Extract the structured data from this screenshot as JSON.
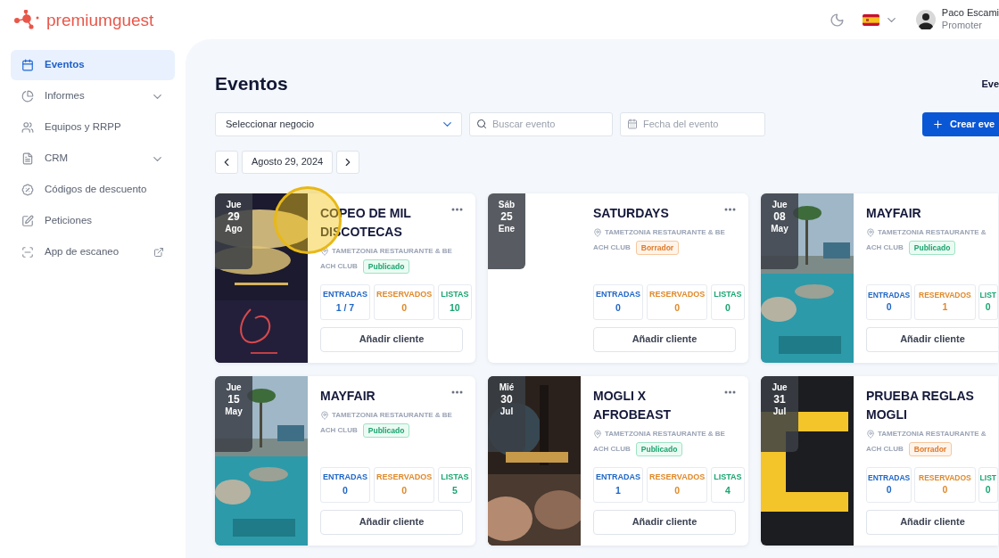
{
  "brand": {
    "name_light": "premium",
    "name_regular": "guest"
  },
  "topbar": {
    "user": {
      "name": "Paco Escami",
      "role": "Promoter"
    }
  },
  "sidebar": {
    "items": [
      {
        "label": "Eventos",
        "selected": true
      },
      {
        "label": "Informes",
        "selected": false,
        "has_submenu": true
      },
      {
        "label": "Equipos y RRPP",
        "selected": false
      },
      {
        "label": "CRM",
        "selected": false,
        "has_submenu": true
      },
      {
        "label": "Códigos de descuento",
        "selected": false
      },
      {
        "label": "Peticiones",
        "selected": false
      },
      {
        "label": "App de escaneo",
        "selected": false,
        "external": true
      }
    ]
  },
  "page": {
    "title": "Eventos",
    "top_right": "Eve",
    "filters": {
      "business": {
        "value": "Seleccionar negocio"
      },
      "search": {
        "placeholder": "Buscar evento"
      },
      "date": {
        "placeholder": "Fecha del evento"
      },
      "create_button": "Crear eve"
    },
    "date_nav": {
      "date": "Agosto 29, 2024"
    }
  },
  "events": [
    {
      "title": "COPEO DE MIL DISCOTECAS",
      "weekday": "Jue",
      "day": "29",
      "month": "Ago",
      "location_lines": [
        "TAMETZONIA RESTAURANTE & BE",
        "ACH CLUB"
      ],
      "status": {
        "label": "Publicado",
        "kind": "published"
      },
      "image": {
        "kind": "picture"
      },
      "stats": [
        {
          "label": "ENTRADAS",
          "value": "1 / 7",
          "kind": "tickets"
        },
        {
          "label": "RESERVADOS",
          "value": "0",
          "kind": "reserved"
        },
        {
          "label": "LISTAS",
          "value": "10",
          "kind": "lists"
        }
      ],
      "action": "Añadir cliente"
    },
    {
      "title": "SATURDAYS",
      "weekday": "Sáb",
      "day": "25",
      "month": "Ene",
      "location_lines": [
        "TAMETZONIA RESTAURANTE & BE",
        "ACH CLUB"
      ],
      "status": {
        "label": "Borrador",
        "kind": "draft"
      },
      "stats": [
        {
          "label": "ENTRADAS",
          "value": "0",
          "kind": "tickets"
        },
        {
          "label": "RESERVADOS",
          "value": "0",
          "kind": "reserved"
        },
        {
          "label": "LISTAS",
          "value": "0",
          "kind": "lists"
        }
      ],
      "action": "Añadir cliente"
    },
    {
      "title": "MAYFAIR",
      "weekday": "Jue",
      "day": "08",
      "month": "May",
      "location_lines": [
        "TAMETZONIA RESTAURANTE &",
        "ACH CLUB"
      ],
      "status": {
        "label": "Publicado",
        "kind": "published"
      },
      "image": {
        "kind": "picture"
      },
      "stats": [
        {
          "label": "ENTRADAS",
          "value": "0",
          "kind": "tickets"
        },
        {
          "label": "RESERVADOS",
          "value": "1",
          "kind": "reserved"
        },
        {
          "label": "LIST",
          "value": "0",
          "kind": "lists"
        }
      ],
      "action": "Añadir cliente"
    },
    {
      "title": "MAYFAIR",
      "weekday": "Jue",
      "day": "15",
      "month": "May",
      "location_lines": [
        "TAMETZONIA RESTAURANTE & BE",
        "ACH CLUB"
      ],
      "status": {
        "label": "Publicado",
        "kind": "published"
      },
      "image": {
        "kind": "picture"
      },
      "stats": [
        {
          "label": "ENTRADAS",
          "value": "0",
          "kind": "tickets"
        },
        {
          "label": "RESERVADOS",
          "value": "0",
          "kind": "reserved"
        },
        {
          "label": "LISTAS",
          "value": "5",
          "kind": "lists"
        }
      ],
      "action": "Añadir cliente"
    },
    {
      "title": "MOGLI X AFROBEAST",
      "weekday": "Mié",
      "day": "30",
      "month": "Jul",
      "location_lines": [
        "TAMETZONIA RESTAURANTE & BE",
        "ACH CLUB"
      ],
      "status": {
        "label": "Publicado",
        "kind": "published"
      },
      "image": {
        "kind": "picture"
      },
      "stats": [
        {
          "label": "ENTRADAS",
          "value": "1",
          "kind": "tickets"
        },
        {
          "label": "RESERVADOS",
          "value": "0",
          "kind": "reserved"
        },
        {
          "label": "LISTAS",
          "value": "4",
          "kind": "lists"
        }
      ],
      "action": "Añadir cliente"
    },
    {
      "title": "PRUEBA REGLAS MOGLI",
      "weekday": "Jue",
      "day": "31",
      "month": "Jul",
      "location_lines": [
        "TAMETZONIA RESTAURANTE &",
        "ACH CLUB"
      ],
      "status": {
        "label": "Borrador",
        "kind": "draft"
      },
      "image": {
        "kind": "picture"
      },
      "stats": [
        {
          "label": "ENTRADAS",
          "value": "0",
          "kind": "tickets"
        },
        {
          "label": "RESERVADOS",
          "value": "0",
          "kind": "reserved"
        },
        {
          "label": "LIST",
          "value": "0",
          "kind": "lists"
        }
      ],
      "action": "Añadir cliente"
    }
  ]
}
